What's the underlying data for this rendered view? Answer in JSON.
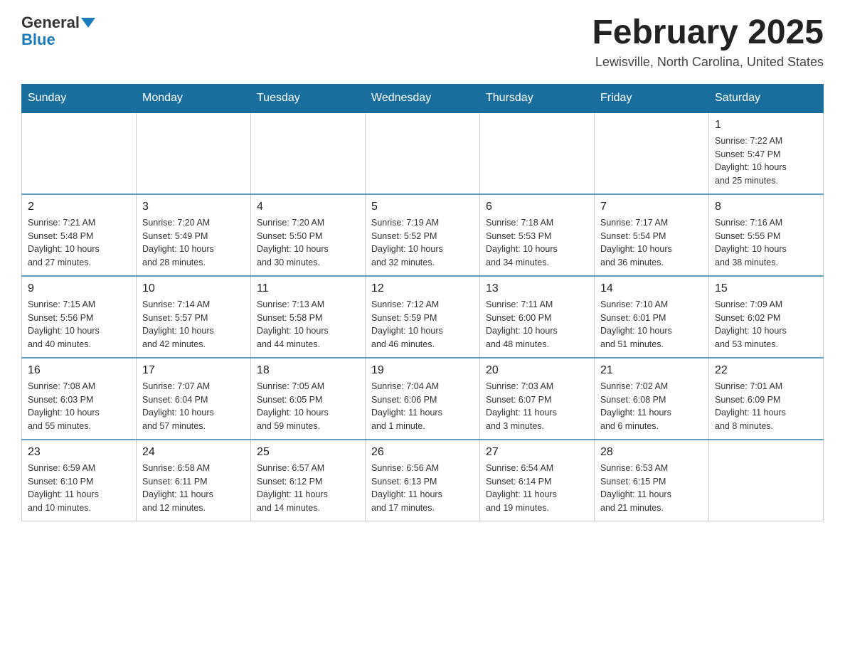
{
  "logo": {
    "general": "General",
    "blue": "Blue"
  },
  "header": {
    "month_title": "February 2025",
    "location": "Lewisville, North Carolina, United States"
  },
  "weekdays": [
    "Sunday",
    "Monday",
    "Tuesday",
    "Wednesday",
    "Thursday",
    "Friday",
    "Saturday"
  ],
  "weeks": [
    [
      {
        "day": "",
        "info": ""
      },
      {
        "day": "",
        "info": ""
      },
      {
        "day": "",
        "info": ""
      },
      {
        "day": "",
        "info": ""
      },
      {
        "day": "",
        "info": ""
      },
      {
        "day": "",
        "info": ""
      },
      {
        "day": "1",
        "info": "Sunrise: 7:22 AM\nSunset: 5:47 PM\nDaylight: 10 hours\nand 25 minutes."
      }
    ],
    [
      {
        "day": "2",
        "info": "Sunrise: 7:21 AM\nSunset: 5:48 PM\nDaylight: 10 hours\nand 27 minutes."
      },
      {
        "day": "3",
        "info": "Sunrise: 7:20 AM\nSunset: 5:49 PM\nDaylight: 10 hours\nand 28 minutes."
      },
      {
        "day": "4",
        "info": "Sunrise: 7:20 AM\nSunset: 5:50 PM\nDaylight: 10 hours\nand 30 minutes."
      },
      {
        "day": "5",
        "info": "Sunrise: 7:19 AM\nSunset: 5:52 PM\nDaylight: 10 hours\nand 32 minutes."
      },
      {
        "day": "6",
        "info": "Sunrise: 7:18 AM\nSunset: 5:53 PM\nDaylight: 10 hours\nand 34 minutes."
      },
      {
        "day": "7",
        "info": "Sunrise: 7:17 AM\nSunset: 5:54 PM\nDaylight: 10 hours\nand 36 minutes."
      },
      {
        "day": "8",
        "info": "Sunrise: 7:16 AM\nSunset: 5:55 PM\nDaylight: 10 hours\nand 38 minutes."
      }
    ],
    [
      {
        "day": "9",
        "info": "Sunrise: 7:15 AM\nSunset: 5:56 PM\nDaylight: 10 hours\nand 40 minutes."
      },
      {
        "day": "10",
        "info": "Sunrise: 7:14 AM\nSunset: 5:57 PM\nDaylight: 10 hours\nand 42 minutes."
      },
      {
        "day": "11",
        "info": "Sunrise: 7:13 AM\nSunset: 5:58 PM\nDaylight: 10 hours\nand 44 minutes."
      },
      {
        "day": "12",
        "info": "Sunrise: 7:12 AM\nSunset: 5:59 PM\nDaylight: 10 hours\nand 46 minutes."
      },
      {
        "day": "13",
        "info": "Sunrise: 7:11 AM\nSunset: 6:00 PM\nDaylight: 10 hours\nand 48 minutes."
      },
      {
        "day": "14",
        "info": "Sunrise: 7:10 AM\nSunset: 6:01 PM\nDaylight: 10 hours\nand 51 minutes."
      },
      {
        "day": "15",
        "info": "Sunrise: 7:09 AM\nSunset: 6:02 PM\nDaylight: 10 hours\nand 53 minutes."
      }
    ],
    [
      {
        "day": "16",
        "info": "Sunrise: 7:08 AM\nSunset: 6:03 PM\nDaylight: 10 hours\nand 55 minutes."
      },
      {
        "day": "17",
        "info": "Sunrise: 7:07 AM\nSunset: 6:04 PM\nDaylight: 10 hours\nand 57 minutes."
      },
      {
        "day": "18",
        "info": "Sunrise: 7:05 AM\nSunset: 6:05 PM\nDaylight: 10 hours\nand 59 minutes."
      },
      {
        "day": "19",
        "info": "Sunrise: 7:04 AM\nSunset: 6:06 PM\nDaylight: 11 hours\nand 1 minute."
      },
      {
        "day": "20",
        "info": "Sunrise: 7:03 AM\nSunset: 6:07 PM\nDaylight: 11 hours\nand 3 minutes."
      },
      {
        "day": "21",
        "info": "Sunrise: 7:02 AM\nSunset: 6:08 PM\nDaylight: 11 hours\nand 6 minutes."
      },
      {
        "day": "22",
        "info": "Sunrise: 7:01 AM\nSunset: 6:09 PM\nDaylight: 11 hours\nand 8 minutes."
      }
    ],
    [
      {
        "day": "23",
        "info": "Sunrise: 6:59 AM\nSunset: 6:10 PM\nDaylight: 11 hours\nand 10 minutes."
      },
      {
        "day": "24",
        "info": "Sunrise: 6:58 AM\nSunset: 6:11 PM\nDaylight: 11 hours\nand 12 minutes."
      },
      {
        "day": "25",
        "info": "Sunrise: 6:57 AM\nSunset: 6:12 PM\nDaylight: 11 hours\nand 14 minutes."
      },
      {
        "day": "26",
        "info": "Sunrise: 6:56 AM\nSunset: 6:13 PM\nDaylight: 11 hours\nand 17 minutes."
      },
      {
        "day": "27",
        "info": "Sunrise: 6:54 AM\nSunset: 6:14 PM\nDaylight: 11 hours\nand 19 minutes."
      },
      {
        "day": "28",
        "info": "Sunrise: 6:53 AM\nSunset: 6:15 PM\nDaylight: 11 hours\nand 21 minutes."
      },
      {
        "day": "",
        "info": ""
      }
    ]
  ]
}
